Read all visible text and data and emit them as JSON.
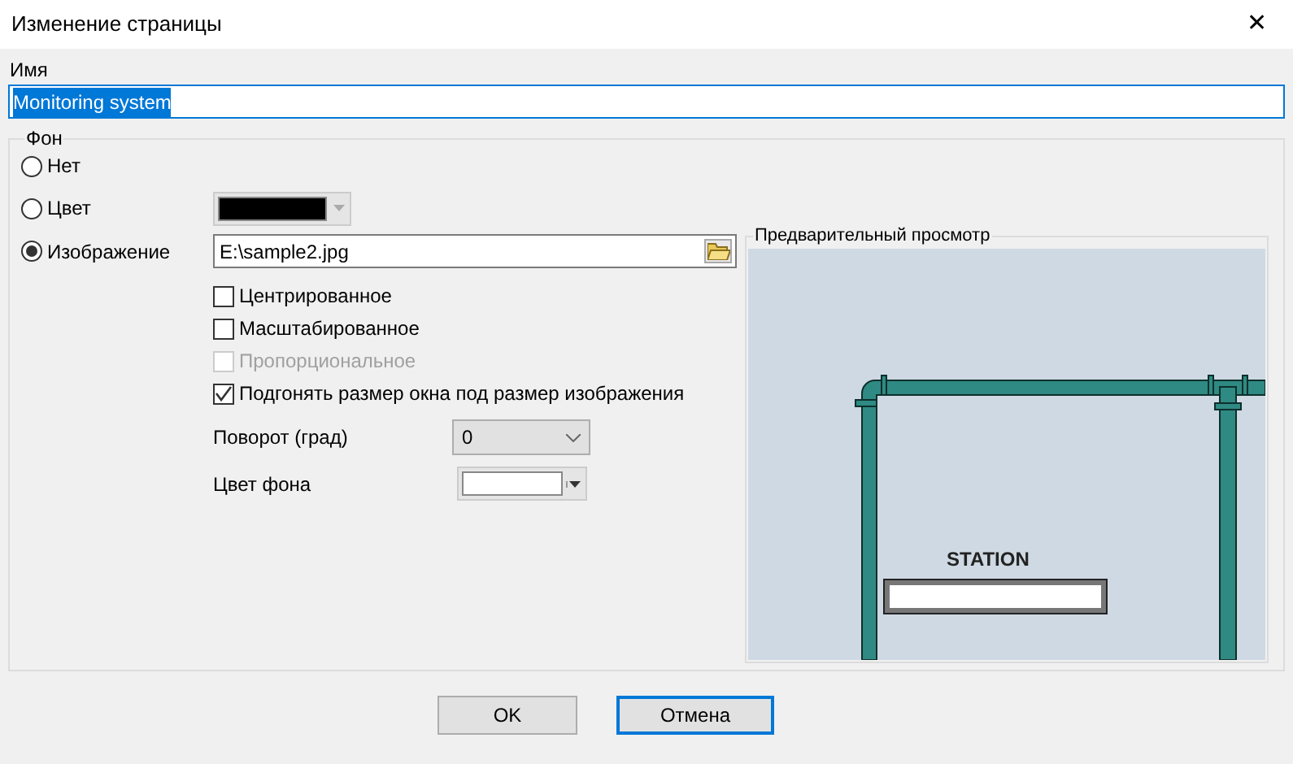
{
  "window": {
    "title": "Изменение страницы",
    "close": "✕"
  },
  "name": {
    "label": "Имя",
    "value": "Monitoring system",
    "text_selected": true
  },
  "background": {
    "title": "Фон",
    "options": [
      {
        "label": "Нет",
        "selected": false
      },
      {
        "label": "Цвет",
        "selected": false,
        "color": "#000000"
      },
      {
        "label": "Изображение",
        "selected": true,
        "path": "E:\\sample2.jpg"
      }
    ],
    "checkboxes": [
      {
        "label": "Центрированное",
        "checked": false,
        "disabled": false
      },
      {
        "label": "Масштабированное",
        "checked": false,
        "disabled": false
      },
      {
        "label": "Пропорциональное",
        "checked": false,
        "disabled": true
      },
      {
        "label": "Подгонять размер окна под размер изображения",
        "checked": true,
        "disabled": false
      }
    ],
    "rotation": {
      "label": "Поворот (град)",
      "value": "0"
    },
    "bg_color": {
      "label": "Цвет фона",
      "color": "#ffffff"
    },
    "preview": {
      "title": "Предварительный просмотр",
      "label": "STATION"
    }
  },
  "buttons": [
    {
      "label": "OK",
      "selected": false
    },
    {
      "label": "Отмена",
      "selected": true
    }
  ]
}
